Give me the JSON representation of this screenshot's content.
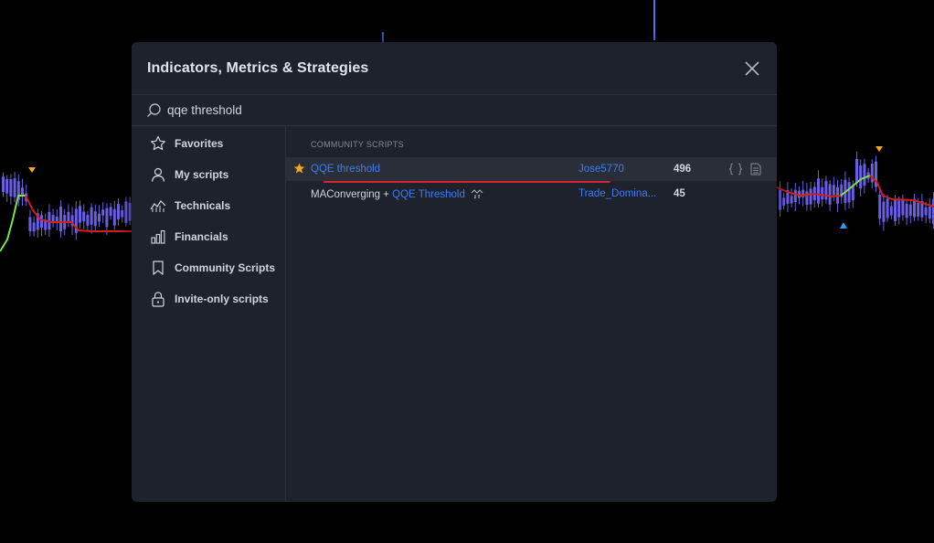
{
  "dialog": {
    "title": "Indicators, Metrics & Strategies",
    "close_icon": "close-icon"
  },
  "search": {
    "value": "qqe threshold",
    "icon": "search-icon"
  },
  "sidebar": {
    "items": [
      {
        "label": "Favorites",
        "icon": "star-icon"
      },
      {
        "label": "My scripts",
        "icon": "user-icon"
      },
      {
        "label": "Technicals",
        "icon": "chart-icon"
      },
      {
        "label": "Financials",
        "icon": "bar-chart-icon"
      },
      {
        "label": "Community Scripts",
        "icon": "bookmark-icon"
      },
      {
        "label": "Invite-only scripts",
        "icon": "lock-icon"
      }
    ]
  },
  "results": {
    "section_title": "COMMUNITY SCRIPTS",
    "rows": [
      {
        "name_plain": "",
        "name_link": "QQE threshold",
        "author": "Jose5770",
        "count": "496",
        "favorite": true,
        "highlighted": true
      },
      {
        "name_plain": "MAConverging + ",
        "name_link": "QQE Threshold",
        "author": "Trade_Domina...",
        "count": "45",
        "favorite": false,
        "highlighted": false
      }
    ]
  },
  "colors": {
    "dialog_bg": "#1e222d",
    "link": "#3d7cf2",
    "star": "#f5a623",
    "underline": "#d9232e",
    "candle": "#6b5ee6",
    "line_red": "#d01f1f",
    "line_green": "#7ce04a"
  }
}
